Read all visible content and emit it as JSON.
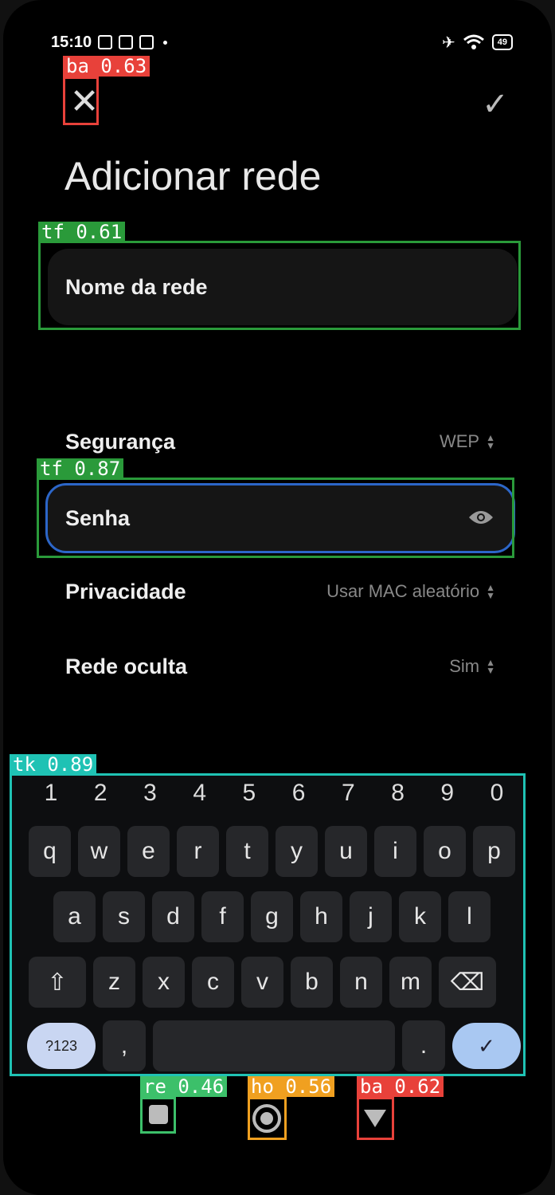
{
  "status_bar": {
    "time": "15:10",
    "battery": "49"
  },
  "header": {
    "close_glyph": "✕",
    "confirm_glyph": "✓",
    "title": "Adicionar rede"
  },
  "form": {
    "network_name_placeholder": "Nome da rede",
    "security_label": "Segurança",
    "security_value": "WEP",
    "password_placeholder": "Senha",
    "privacy_label": "Privacidade",
    "privacy_value": "Usar MAC aleatório",
    "hidden_label": "Rede oculta",
    "hidden_value": "Sim"
  },
  "keyboard": {
    "numbers": [
      "1",
      "2",
      "3",
      "4",
      "5",
      "6",
      "7",
      "8",
      "9",
      "0"
    ],
    "row1": [
      "q",
      "w",
      "e",
      "r",
      "t",
      "y",
      "u",
      "i",
      "o",
      "p"
    ],
    "row2": [
      "a",
      "s",
      "d",
      "f",
      "g",
      "h",
      "j",
      "k",
      "l"
    ],
    "row3": [
      "z",
      "x",
      "c",
      "v",
      "b",
      "n",
      "m"
    ],
    "symbols_label": "?123",
    "comma": ",",
    "period": ".",
    "enter_glyph": "✓",
    "shift_glyph": "⇧",
    "backspace_glyph": "⌫"
  },
  "annotations": [
    {
      "label": "ba 0.63",
      "color": "#e8413a"
    },
    {
      "label": "tf 0.61",
      "color": "#2a9a3a"
    },
    {
      "label": "tf 0.87",
      "color": "#2a9a3a"
    },
    {
      "label": "tk 0.89",
      "color": "#1fc2b4"
    },
    {
      "label": "re 0.46",
      "color": "#3cc06a"
    },
    {
      "label": "ho 0.56",
      "color": "#f0a020"
    },
    {
      "label": "ba 0.62",
      "color": "#e8413a"
    }
  ]
}
